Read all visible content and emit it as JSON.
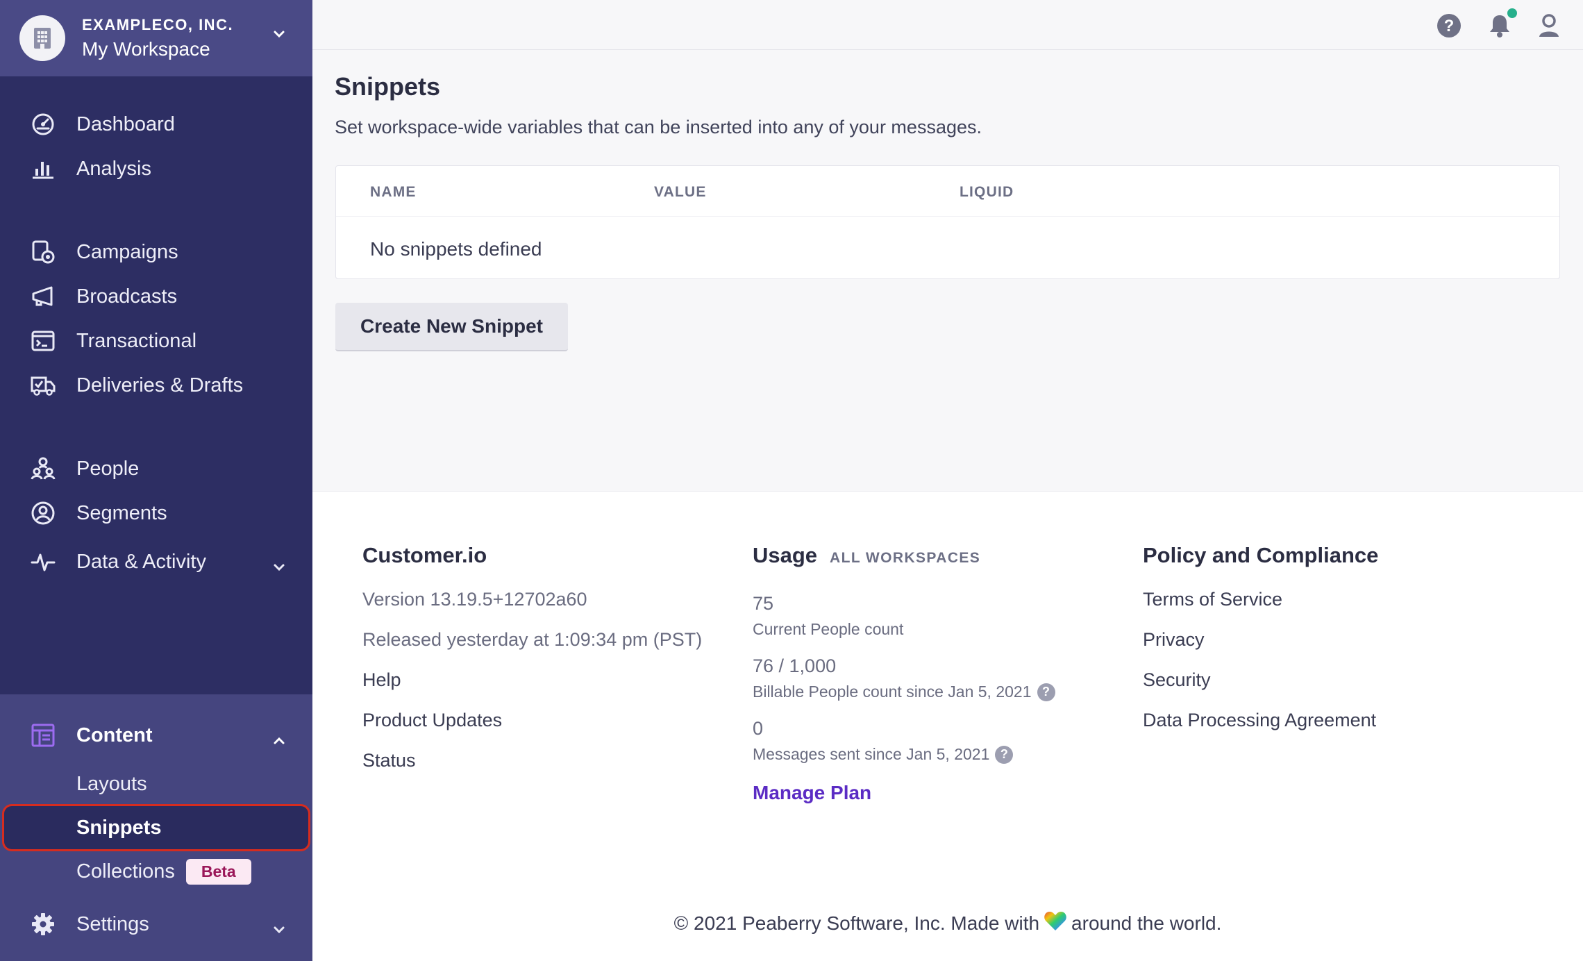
{
  "workspace": {
    "company": "EXAMPLECO, INC.",
    "name": "My Workspace"
  },
  "nav": {
    "dashboard": "Dashboard",
    "analysis": "Analysis",
    "campaigns": "Campaigns",
    "broadcasts": "Broadcasts",
    "transactional": "Transactional",
    "deliveries": "Deliveries & Drafts",
    "people": "People",
    "segments": "Segments",
    "data_activity": "Data & Activity",
    "content": "Content",
    "layouts": "Layouts",
    "snippets": "Snippets",
    "collections": "Collections",
    "collections_badge": "Beta",
    "settings": "Settings"
  },
  "page": {
    "title": "Snippets",
    "description": "Set workspace-wide variables that can be inserted into any of your messages."
  },
  "table": {
    "columns": [
      "NAME",
      "VALUE",
      "LIQUID"
    ],
    "empty_message": "No snippets defined"
  },
  "create_button": "Create New Snippet",
  "footer": {
    "brand": {
      "title": "Customer.io",
      "version": "Version 13.19.5+12702a60",
      "released": "Released yesterday at 1:09:34 pm (PST)",
      "links": [
        "Help",
        "Product Updates",
        "Status"
      ]
    },
    "usage": {
      "title": "Usage",
      "scope": "ALL WORKSPACES",
      "stats": [
        {
          "value": "75",
          "label": "Current People count",
          "help": false
        },
        {
          "value": "76 / 1,000",
          "label": "Billable People count since Jan 5, 2021",
          "help": true
        },
        {
          "value": "0",
          "label": "Messages sent since Jan 5, 2021",
          "help": true
        }
      ],
      "manage_plan": "Manage Plan"
    },
    "policy": {
      "title": "Policy and Compliance",
      "links": [
        "Terms of Service",
        "Privacy",
        "Security",
        "Data Processing Agreement"
      ]
    },
    "copyright_before": "© 2021 Peaberry Software, Inc. Made with",
    "copyright_after": "around the world."
  },
  "colors": {
    "sidebar": "#2d2e63",
    "sidebar_highlight": "#45457f",
    "active_outline": "#d62c1f",
    "link_purple": "#5b2cc4",
    "notification_dot": "#26b08c"
  }
}
